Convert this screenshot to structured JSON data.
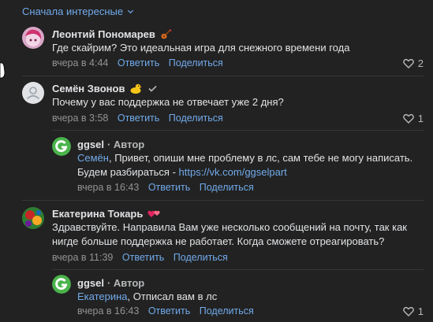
{
  "sort": {
    "label": "Сначала интересные"
  },
  "comments": [
    {
      "author": "Леонтий Пономарев",
      "text": "Где скайрим? Это идеальная игра для снежного времени года",
      "time": "вчера в 4:44",
      "reply": "Ответить",
      "share": "Поделиться",
      "likes": "2"
    },
    {
      "author": "Семён Звонов",
      "text": "Почему у вас поддержка не отвечает уже 2 дня?",
      "time": "вчера в 3:58",
      "reply": "Ответить",
      "share": "Поделиться",
      "likes": "1",
      "replies": [
        {
          "author": "ggsel",
          "badge": "· Автор",
          "mention": "Семён",
          "text": ", Привет, опиши мне проблему в лс, сам тебе не могу написать. Будем разбираться - ",
          "link": "https://vk.com/ggselpart",
          "time": "вчера в 16:43",
          "reply": "Ответить",
          "share": "Поделиться"
        }
      ]
    },
    {
      "author": "Екатерина Токарь",
      "text": "Здравствуйте. Направила Вам уже несколько сообщений на почту, так как нигде больше поддержка не работает. Когда сможете отреагировать?",
      "time": "вчера в 11:39",
      "reply": "Ответить",
      "share": "Поделиться",
      "replies": [
        {
          "author": "ggsel",
          "badge": "· Автор",
          "mention": "Екатерина",
          "text": ", Отписал вам в лс",
          "time": "вчера в 16:43",
          "reply": "Ответить",
          "share": "Поделиться",
          "likes": "1"
        }
      ]
    }
  ],
  "colors": {
    "background": "#222222",
    "link": "#71aaeb",
    "meta": "#939393",
    "text": "#e1e3e6",
    "ggsel_green": "#4bb34b"
  }
}
